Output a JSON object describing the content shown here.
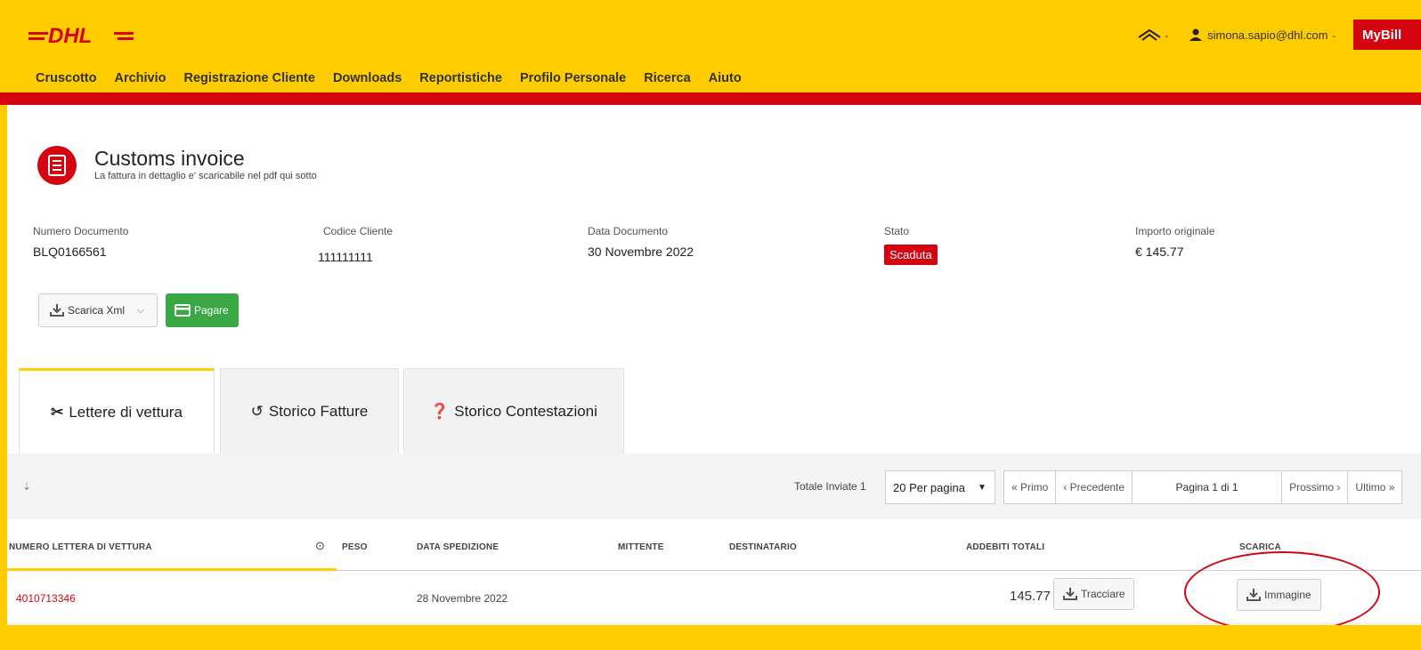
{
  "header": {
    "logo_text": "DHL",
    "user_email": "simona.sapio@dhl.com",
    "app_button": "MyBill",
    "nav": [
      "Cruscotto",
      "Archivio",
      "Registrazione Cliente",
      "Downloads",
      "Reportistiche",
      "Profilo Personale",
      "Ricerca",
      "Aiuto"
    ],
    "colors": {
      "brand_yellow": "#ffcc00",
      "brand_red": "#d40511",
      "pay_green": "#3aa845"
    }
  },
  "page": {
    "title": "Customs invoice",
    "subtitle": "La fattura in dettaglio e' scaricabile nel pdf qui sotto"
  },
  "info": {
    "numero_documento_label": "Numero Documento",
    "numero_documento": "BLQ0166561",
    "codice_cliente_label": "Codice Cliente",
    "codice_cliente": "111111111",
    "data_documento_label": "Data Documento",
    "data_documento": "30 Novembre 2022",
    "stato_label": "Stato",
    "stato": "Scaduta",
    "importo_label": "Importo originale",
    "importo": "€ 145.77"
  },
  "actions": {
    "scarica_xml": "Scarica Xml",
    "pagare": "Pagare"
  },
  "tabs": [
    {
      "label": "Lettere di vettura",
      "icon": "scissors-icon",
      "active": true
    },
    {
      "label": "Storico Fatture",
      "icon": "history-icon",
      "active": false
    },
    {
      "label": "Storico Contestazioni",
      "icon": "question-icon",
      "active": false
    }
  ],
  "table": {
    "totale": "Totale Inviate 1",
    "per_page": "20 Per pagina",
    "pager": {
      "first": "« Primo",
      "prev": "‹ Precedente",
      "current": "Pagina 1 di 1",
      "next": "Prossimo ›",
      "last": "Ultimo »"
    },
    "columns": [
      "NUMERO LETTERA DI VETTURA",
      "PESO",
      "DATA SPEDIZIONE",
      "MITTENTE",
      "DESTINATARIO",
      "ADDEBITI TOTALI",
      "SCARICA"
    ],
    "rows": [
      {
        "numero": "4010713346",
        "peso": "",
        "data": "28 Novembre 2022",
        "mittente": "",
        "destinatario": "",
        "addebiti": "145.77",
        "track_label": "Tracciare",
        "download_label": "Immagine"
      }
    ]
  }
}
